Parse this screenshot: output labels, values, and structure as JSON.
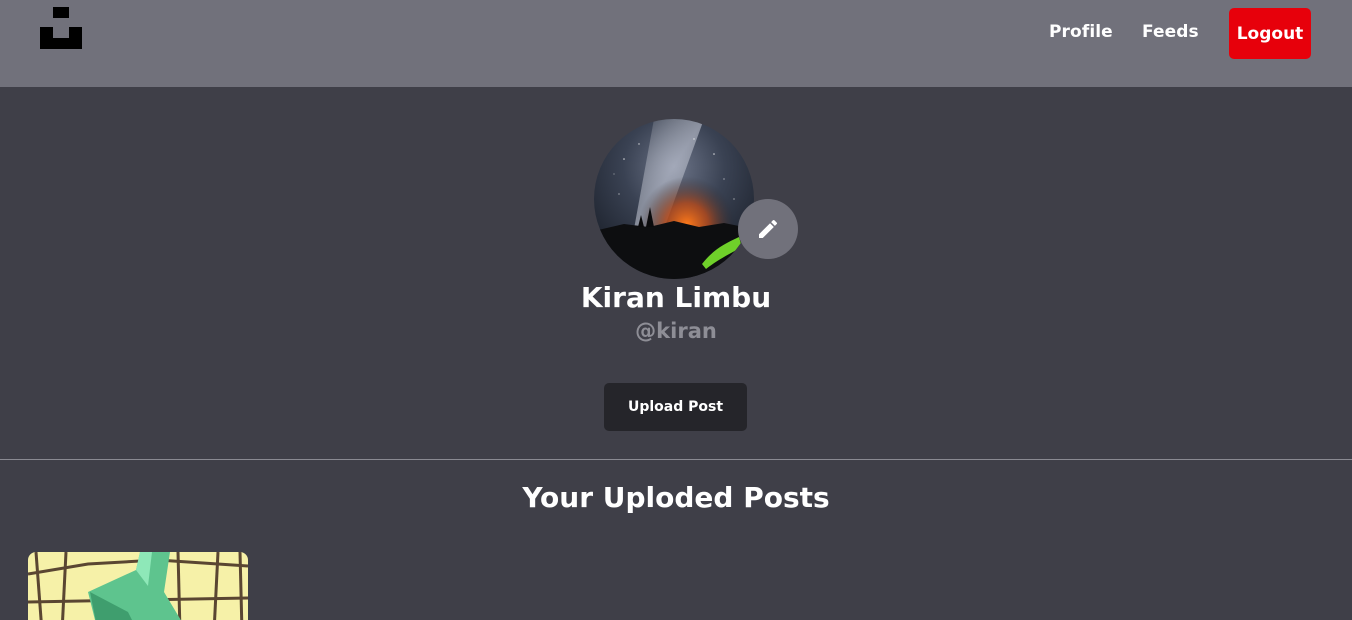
{
  "nav": {
    "logo_icon": "brand-logo-icon",
    "links": [
      {
        "label": "Profile"
      },
      {
        "label": "Feeds"
      }
    ],
    "logout_label": "Logout"
  },
  "profile": {
    "name": "Kiran Limbu",
    "handle": "@kiran",
    "edit_icon": "pencil-icon",
    "upload_label": "Upload Post"
  },
  "posts_section": {
    "title": "Your Uploded Posts",
    "post_count_visible": 1
  },
  "colors": {
    "navbar_bg": "#71717b",
    "page_bg": "#3f3f48",
    "logout_bg": "#e7000b",
    "upload_bg": "#25252a",
    "handle_text": "#8e8e96"
  }
}
